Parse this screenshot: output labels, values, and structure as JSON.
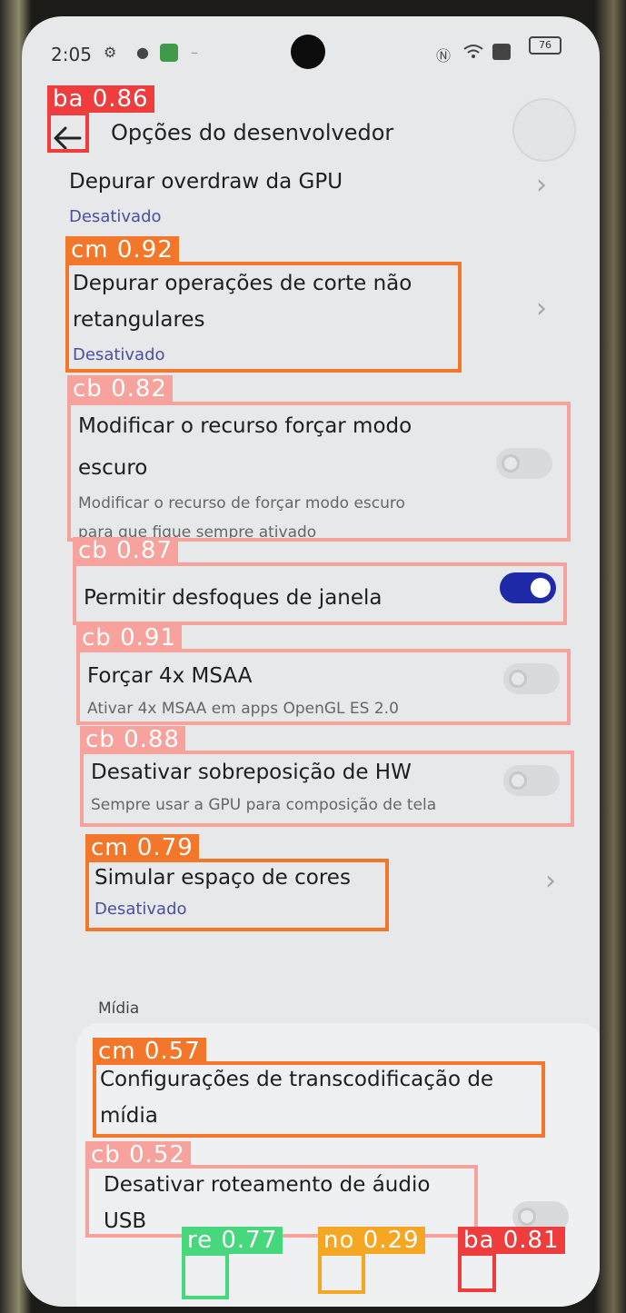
{
  "status_bar": {
    "time": "2:05",
    "battery": "76"
  },
  "header": {
    "title": "Opções do desenvolvedor"
  },
  "items": [
    {
      "title": "Depurar overdraw da GPU",
      "subtitle": "Desativado"
    },
    {
      "title_line1": "Depurar operações de corte não",
      "title_line2": "retangulares",
      "subtitle": "Desativado"
    },
    {
      "title_line1": "Modificar o recurso forçar modo",
      "title_line2": "escuro",
      "desc_line1": "Modificar o recurso de forçar modo escuro",
      "desc_line2": "para que fique sempre ativado",
      "toggle": "off"
    },
    {
      "title": "Permitir desfoques de janela",
      "toggle": "on"
    },
    {
      "title": "Forçar 4x MSAA",
      "desc": "Ativar 4x MSAA em apps OpenGL ES 2.0",
      "toggle": "off"
    },
    {
      "title": "Desativar sobreposição de HW",
      "desc": "Sempre usar a GPU para composição de tela",
      "toggle": "off"
    },
    {
      "title": "Simular espaço de cores",
      "subtitle": "Desativado"
    }
  ],
  "media_section": {
    "label": "Mídia",
    "items": [
      {
        "title_line1": "Configurações de transcodificação de",
        "title_line2": "mídia"
      },
      {
        "title_line1": "Desativar roteamento de áudio",
        "title_line2": "USB",
        "toggle": "off"
      }
    ]
  },
  "detections": [
    {
      "label": "ba 0.86",
      "color": "#ef3c3c"
    },
    {
      "label": "cm 0.92",
      "color": "#f3772a"
    },
    {
      "label": "cb 0.82",
      "color": "#f7a29c"
    },
    {
      "label": "cb 0.87",
      "color": "#f7a29c"
    },
    {
      "label": "cb 0.91",
      "color": "#f7a29c"
    },
    {
      "label": "cb 0.88",
      "color": "#f7a29c"
    },
    {
      "label": "cm 0.79",
      "color": "#f3772a"
    },
    {
      "label": "cm 0.57",
      "color": "#f3772a"
    },
    {
      "label": "cb 0.52",
      "color": "#f7a29c"
    },
    {
      "label": "re 0.77",
      "color": "#47d77d"
    },
    {
      "label": "no 0.29",
      "color": "#f5a623"
    },
    {
      "label": "ba 0.81",
      "color": "#ef3c3c"
    }
  ]
}
